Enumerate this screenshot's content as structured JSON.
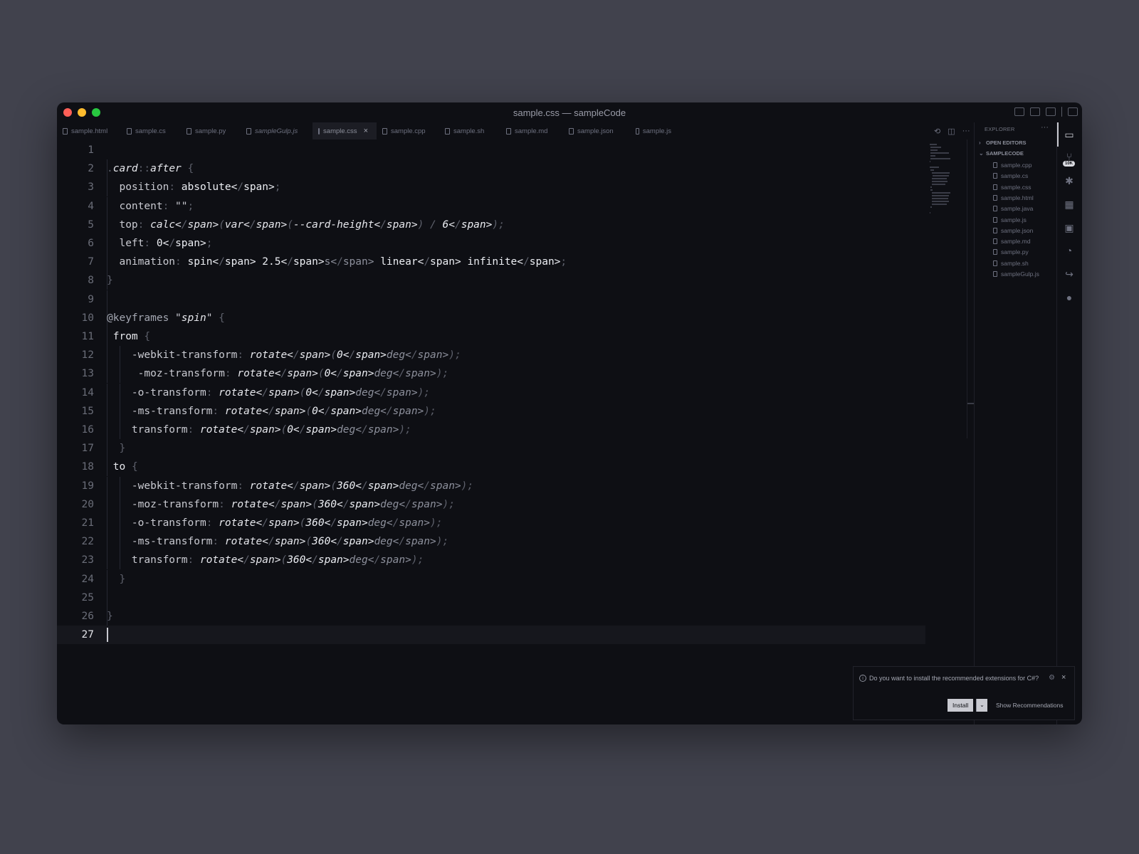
{
  "window": {
    "title": "sample.css — sampleCode"
  },
  "tabs": [
    {
      "label": "sample.html",
      "active": false,
      "italic": false
    },
    {
      "label": "sample.cs",
      "active": false,
      "italic": false
    },
    {
      "label": "sample.py",
      "active": false,
      "italic": false
    },
    {
      "label": "sampleGulp.js",
      "active": false,
      "italic": true
    },
    {
      "label": "sample.css",
      "active": true,
      "italic": false
    },
    {
      "label": "sample.cpp",
      "active": false,
      "italic": false
    },
    {
      "label": "sample.sh",
      "active": false,
      "italic": false
    },
    {
      "label": "sample.md",
      "active": false,
      "italic": false
    },
    {
      "label": "sample.json",
      "active": false,
      "italic": false
    },
    {
      "label": "sample.js",
      "active": false,
      "italic": false
    }
  ],
  "editor": {
    "lines": [
      {
        "n": "1",
        "code": ""
      },
      {
        "n": "2",
        "code": ".card::after {"
      },
      {
        "n": "3",
        "code": "  position: absolute;"
      },
      {
        "n": "4",
        "code": "  content: \"\";"
      },
      {
        "n": "5",
        "code": "  top: calc(var(--card-height) / 6);"
      },
      {
        "n": "6",
        "code": "  left: 0;"
      },
      {
        "n": "7",
        "code": "  animation: spin 2.5s linear infinite;"
      },
      {
        "n": "8",
        "code": "}"
      },
      {
        "n": "9",
        "code": ""
      },
      {
        "n": "10",
        "code": "@keyframes \"spin\" {"
      },
      {
        "n": "11",
        "code": " from {"
      },
      {
        "n": "12",
        "code": "    -webkit-transform: rotate(0deg);"
      },
      {
        "n": "13",
        "code": "     -moz-transform: rotate(0deg);"
      },
      {
        "n": "14",
        "code": "    -o-transform: rotate(0deg);"
      },
      {
        "n": "15",
        "code": "    -ms-transform: rotate(0deg);"
      },
      {
        "n": "16",
        "code": "    transform: rotate(0deg);"
      },
      {
        "n": "17",
        "code": "  }"
      },
      {
        "n": "18",
        "code": " to {"
      },
      {
        "n": "19",
        "code": "    -webkit-transform: rotate(360deg);"
      },
      {
        "n": "20",
        "code": "    -moz-transform: rotate(360deg);"
      },
      {
        "n": "21",
        "code": "    -o-transform: rotate(360deg);"
      },
      {
        "n": "22",
        "code": "    -ms-transform: rotate(360deg);"
      },
      {
        "n": "23",
        "code": "    transform: rotate(360deg);"
      },
      {
        "n": "24",
        "code": "  }"
      },
      {
        "n": "25",
        "code": ""
      },
      {
        "n": "26",
        "code": "}"
      },
      {
        "n": "27",
        "code": ""
      }
    ],
    "current_line": "27"
  },
  "sidebar": {
    "header": "EXPLORER",
    "more": "···",
    "open_editors": "OPEN EDITORS",
    "project": "SAMPLECODE",
    "files": [
      "sample.cpp",
      "sample.cs",
      "sample.css",
      "sample.html",
      "sample.java",
      "sample.js",
      "sample.json",
      "sample.md",
      "sample.py",
      "sample.sh",
      "sampleGulp.js"
    ]
  },
  "activity": {
    "badge": "10K"
  },
  "notification": {
    "message": "Do you want to install the recommended extensions for C#?",
    "install": "Install",
    "show": "Show Recommendations"
  }
}
